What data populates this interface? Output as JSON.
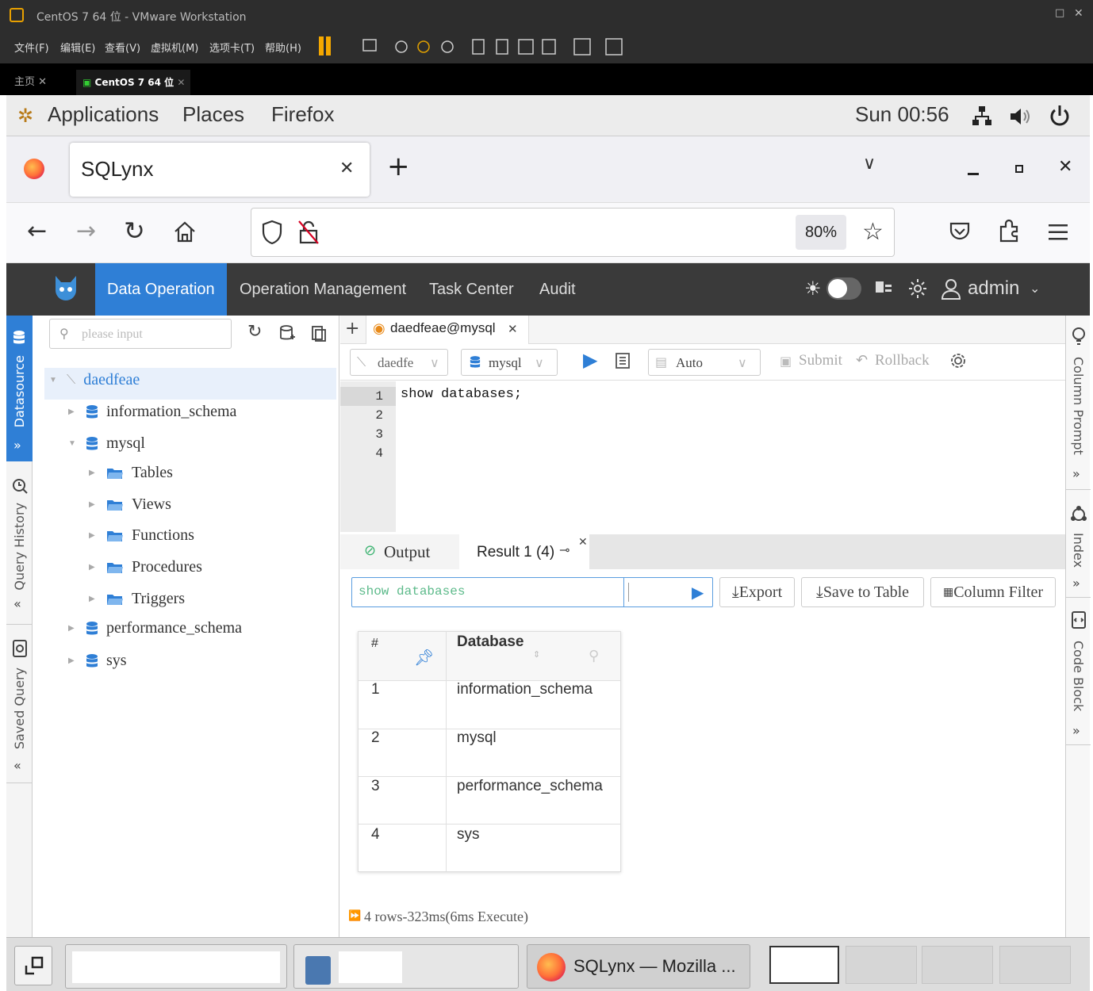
{
  "vm": {
    "title": "CentOS 7 64 位 - VMware Workstation",
    "menu": [
      "文件(F)",
      "编辑(E)",
      "查看(V)",
      "虚拟机(M)",
      "选项卡(T)",
      "帮助(H)"
    ],
    "tabs": [
      {
        "label": "主页"
      },
      {
        "label": "CentOS 7 64 位"
      }
    ]
  },
  "gnome": {
    "menus": [
      "Applications",
      "Places",
      "Firefox"
    ],
    "clock": "Sun 00:56"
  },
  "firefox": {
    "tab_title": "SQLynx",
    "zoom": "80%"
  },
  "app": {
    "nav": [
      "Data Operation",
      "Operation Management",
      "Task Center",
      "Audit"
    ],
    "user": "admin",
    "left_rail": [
      "Datasource",
      "Query History",
      "Saved Query"
    ],
    "right_rail": [
      "Column Prompt",
      "Index",
      "Code Block"
    ],
    "search_placeholder": "please input",
    "tree": {
      "root": "daedfeae",
      "dbs": [
        "information_schema",
        "mysql",
        "performance_schema",
        "sys"
      ],
      "mysql_children": [
        "Tables",
        "Views",
        "Functions",
        "Procedures",
        "Triggers"
      ]
    },
    "editor_tab": "daedfeae@mysql",
    "toolbar": {
      "conn": "daedfe",
      "db": "mysql",
      "mode": "Auto",
      "submit": "Submit",
      "rollback": "Rollback"
    },
    "editor": {
      "line_numbers": [
        "1",
        "2",
        "3",
        "4"
      ],
      "code": "show databases;"
    },
    "results": {
      "tabs": [
        "Output",
        "Result 1 (4)"
      ],
      "filter_value": "show databases",
      "buttons": [
        "Export",
        "Save to Table",
        "Column Filter"
      ],
      "columns": [
        "#",
        "Database"
      ],
      "rows": [
        [
          "1",
          "information_schema"
        ],
        [
          "2",
          "mysql"
        ],
        [
          "3",
          "performance_schema"
        ],
        [
          "4",
          "sys"
        ]
      ],
      "status": "4 rows-323ms(6ms Execute)"
    }
  },
  "taskbar": {
    "firefox_window": "SQLynx — Mozilla ..."
  }
}
